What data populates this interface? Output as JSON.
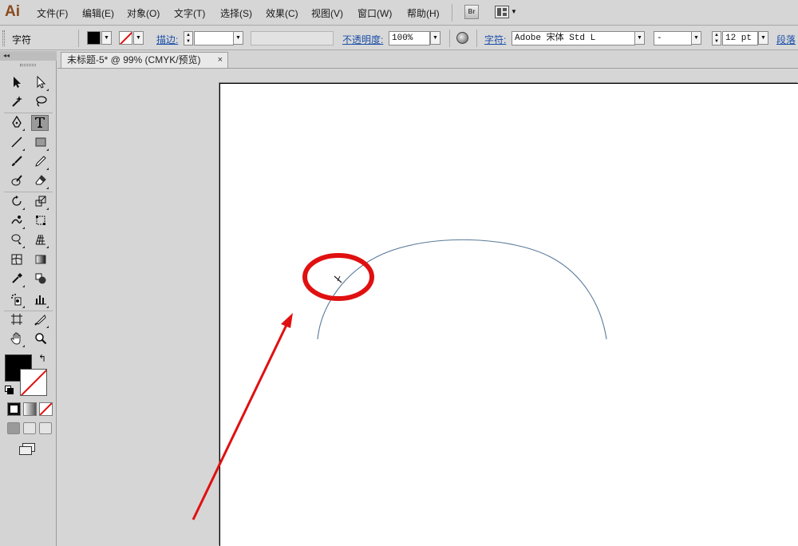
{
  "app": {
    "logo": "Ai"
  },
  "menu": {
    "items": [
      "文件(F)",
      "编辑(E)",
      "对象(O)",
      "文字(T)",
      "选择(S)",
      "效果(C)",
      "视图(V)",
      "窗口(W)",
      "帮助(H)"
    ],
    "bridge_label": "Br"
  },
  "control_bar": {
    "context_label": "字符",
    "stroke_label": "描边:",
    "opacity_label": "不透明度:",
    "opacity_value": "100%",
    "char_label": "字符:",
    "font_family": "Adobe 宋体 Std L",
    "font_style": "-",
    "font_size": "12 pt",
    "paragraph_label": "段落"
  },
  "document": {
    "tab_title": "未标题-5* @ 99% (CMYK/预览)",
    "close_glyph": "×"
  },
  "toolbox": {
    "collapse_glyph": "◂◂",
    "swap_glyph": "↰"
  },
  "colors": {
    "fill": "#000000",
    "stroke": "none",
    "annotation_red": "#e01010",
    "path_stroke": "#5a7a9a"
  },
  "icons": [
    "selection-icon",
    "direct-selection-icon",
    "magic-wand-icon",
    "lasso-icon",
    "pen-icon",
    "type-icon",
    "line-segment-icon",
    "rectangle-icon",
    "paintbrush-icon",
    "pencil-icon",
    "blob-brush-icon",
    "eraser-icon",
    "rotate-icon",
    "scale-icon",
    "warp-icon",
    "free-transform-icon",
    "shape-builder-icon",
    "perspective-grid-icon",
    "mesh-icon",
    "gradient-icon",
    "eyedropper-icon",
    "blend-icon",
    "symbol-sprayer-icon",
    "column-graph-icon",
    "artboard-icon",
    "slice-icon",
    "hand-icon",
    "zoom-icon"
  ]
}
